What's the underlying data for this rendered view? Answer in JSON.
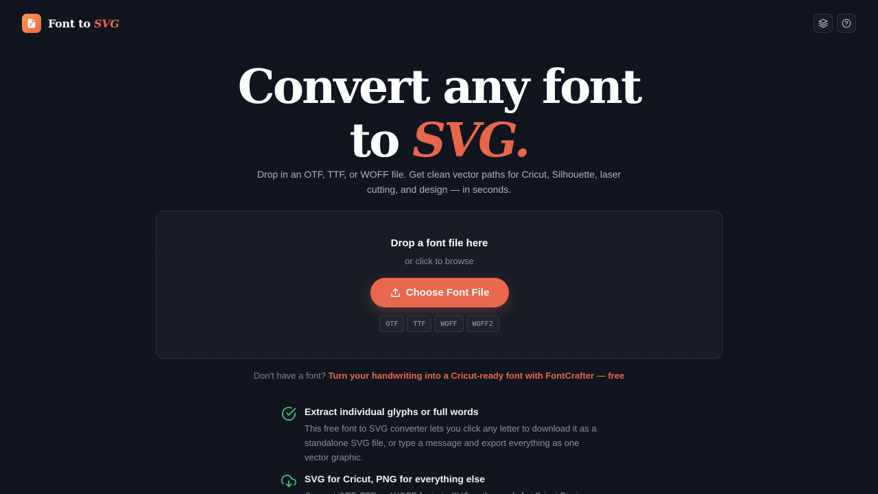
{
  "brand": {
    "name_prefix": "Font to",
    "name_accent": "SVG",
    "icon": "document-icon"
  },
  "header_icons": [
    "layers-icon",
    "help-icon"
  ],
  "hero": {
    "line1": "Convert any font",
    "line2_prefix": "to",
    "line2_accent": "SVG.",
    "subtitle": "Drop in an OTF, TTF, or WOFF file. Get clean vector paths for Cricut, Silhouette, laser cutting, and design — in seconds."
  },
  "dropzone": {
    "title": "Drop a font file here",
    "subtitle": "or click to browse",
    "button_label": "Choose Font File",
    "button_icon": "upload-icon",
    "formats": [
      "OTF",
      "TTF",
      "WOFF",
      "WOFF2"
    ]
  },
  "cta": {
    "prefix": "Don't have a font?",
    "link": "Turn your handwriting into a Cricut-ready font with FontCrafter — free"
  },
  "features": [
    {
      "icon": "check-circle-icon",
      "title": "Extract individual glyphs or full words",
      "body": "This free font to SVG converter lets you click any letter to download it as a standalone SVG file, or type a message and export everything as one vector graphic."
    },
    {
      "icon": "cloud-download-icon",
      "title": "SVG for Cricut, PNG for everything else",
      "body": "Convert OTF, TTF, or WOFF fonts to SVG paths ready for Cricut Design"
    }
  ],
  "colors": {
    "accent": "#e8674d",
    "background": "#111520",
    "success": "#3ec27a"
  }
}
